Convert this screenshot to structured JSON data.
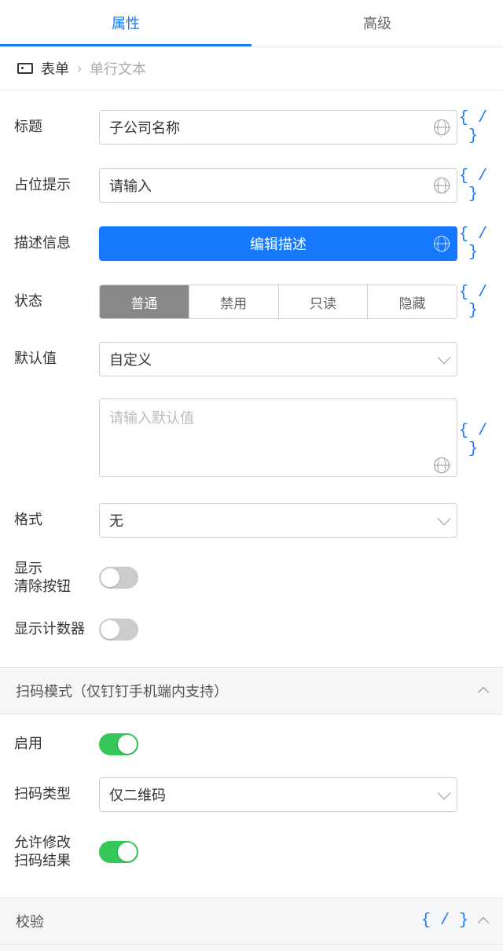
{
  "tabs": {
    "attr": "属性",
    "adv": "高级"
  },
  "crumbs": {
    "form": "表单",
    "current": "单行文本"
  },
  "labels": {
    "title": "标题",
    "placeholder": "占位提示",
    "desc": "描述信息",
    "status": "状态",
    "default": "默认值",
    "format": "格式",
    "showClear": "显示\n清除按钮",
    "showCounter": "显示计数器",
    "enable": "启用",
    "scanType": "扫码类型",
    "allowEdit": "允许修改\n扫码结果"
  },
  "fields": {
    "titleValue": "子公司名称",
    "placeholderValue": "请输入",
    "editDesc": "编辑描述",
    "statusOptions": [
      "普通",
      "禁用",
      "只读",
      "隐藏"
    ],
    "statusActive": 0,
    "defaultSelect": "自定义",
    "defaultPlaceholder": "请输入默认值",
    "formatSelect": "无",
    "scanTypeSelect": "仅二维码"
  },
  "expr": "{ / }",
  "sections": {
    "scan": "扫码模式（仅钉钉手机端内支持）",
    "validate": "校验"
  }
}
